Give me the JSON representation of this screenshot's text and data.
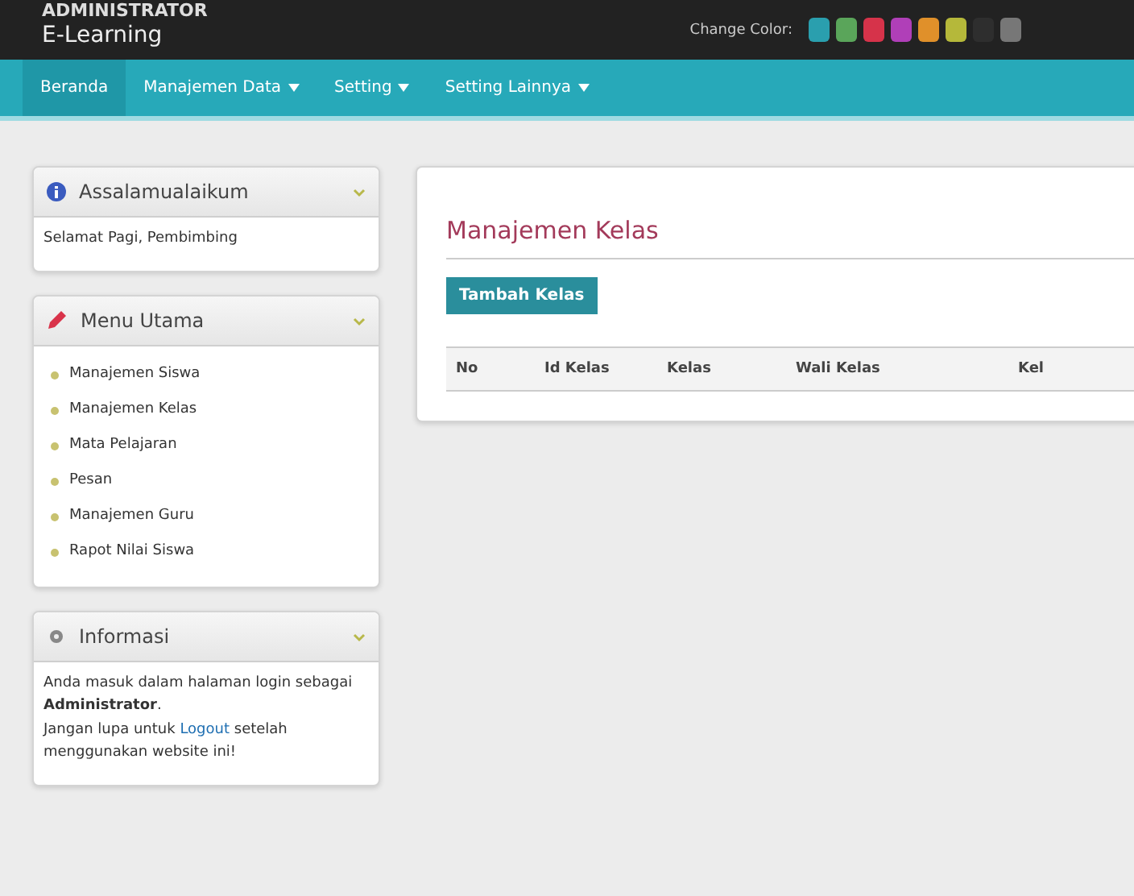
{
  "header": {
    "role": "ADMINISTRATOR",
    "app": "E-Learning",
    "color_label": "Change Color:",
    "swatches": [
      {
        "color": "#2a9fae"
      },
      {
        "color": "#5aa55a"
      },
      {
        "color": "#d6334a"
      },
      {
        "color": "#b03fb8"
      },
      {
        "color": "#e0902a"
      },
      {
        "color": "#b5b83a"
      },
      {
        "color": "#2e2e2e"
      },
      {
        "color": "#777777"
      }
    ]
  },
  "nav": [
    {
      "label": "Beranda",
      "caret": false,
      "selected": true
    },
    {
      "label": "Manajemen Data",
      "caret": true,
      "selected": false
    },
    {
      "label": "Setting",
      "caret": true,
      "selected": false
    },
    {
      "label": "Setting Lainnya",
      "caret": true,
      "selected": false
    }
  ],
  "sidebar": [
    {
      "kind": "text",
      "title": "Assalamualaikum",
      "body": [
        [
          {
            "kind": "text",
            "text": "Selamat Pagi, Pembimbing"
          }
        ]
      ]
    },
    {
      "kind": "menu",
      "title": "Menu Utama",
      "items": [
        "Manajemen Siswa",
        "Manajemen Kelas",
        "Mata Pelajaran",
        "Pesan",
        "Manajemen Guru",
        "Rapot Nilai Siswa"
      ]
    },
    {
      "kind": "text",
      "title": "Informasi",
      "body": [
        [
          {
            "kind": "text",
            "text": "Anda masuk dalam halaman login sebagai **Administrator**."
          }
        ],
        [
          {
            "kind": "text",
            "text": "Jangan lupa untuk "
          },
          {
            "kind": "link",
            "text": "Logout"
          },
          {
            "kind": "text",
            "text": " setelah menggunakan website ini!"
          }
        ]
      ]
    }
  ],
  "main": {
    "title": "Manajemen Kelas",
    "button": "Tambah Kelas",
    "columns": [
      "No",
      "Id Kelas",
      "Kelas",
      "Wali Kelas",
      "Kel"
    ]
  }
}
